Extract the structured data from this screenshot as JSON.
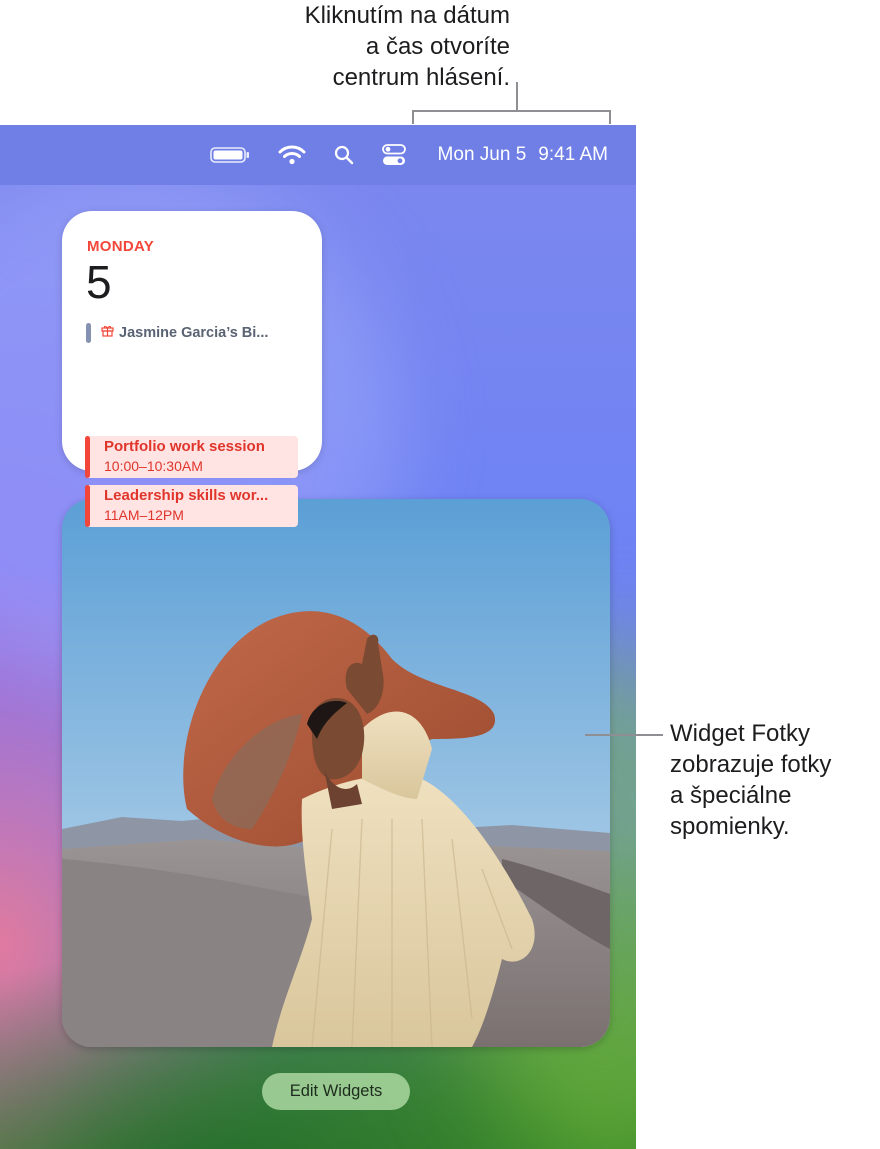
{
  "callouts": {
    "top": [
      "Kliknutím na dátum",
      "a čas otvoríte",
      "centrum hlásení."
    ],
    "right": [
      "Widget Fotky",
      "zobrazuje fotky",
      "a špeciálne",
      "spomienky."
    ]
  },
  "menubar": {
    "date": "Mon Jun 5",
    "time": "9:41 AM",
    "background": "#6f7fe6",
    "icons": [
      "battery-icon",
      "wifi-icon",
      "search-icon",
      "control-center-icon"
    ]
  },
  "calendar_widget": {
    "day_label": "MONDAY",
    "date_number": "5",
    "all_day_event": {
      "title": "Jasmine Garcia’s Bi...",
      "icon": "gift-icon"
    },
    "events": [
      {
        "title": "Portfolio work session",
        "time": "10:00–10:30AM"
      },
      {
        "title": "Leadership skills wor...",
        "time": "11AM–12PM"
      }
    ],
    "accent": "#f2463a"
  },
  "photos_widget": {
    "subject": "woman-in-wide-brim-hat-photo"
  },
  "edit_widgets_button": {
    "label": "Edit Widgets"
  }
}
